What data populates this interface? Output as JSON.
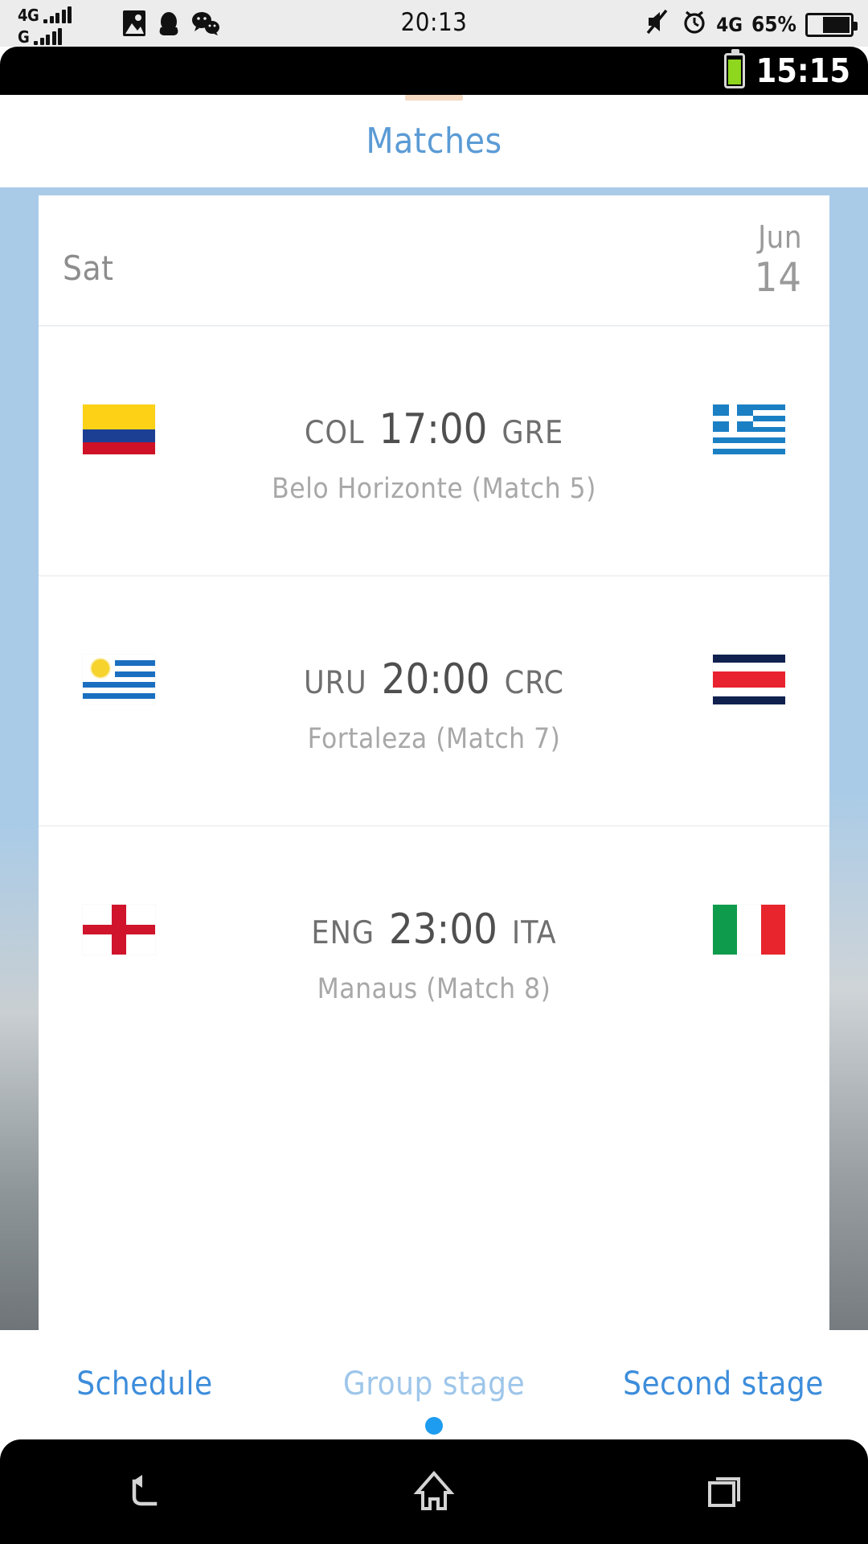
{
  "os_status_bar": {
    "network_rows": [
      {
        "label": "4G",
        "icon": "signal-bars-icon",
        "bars": 5
      },
      {
        "label": "G",
        "icon": "signal-bars-icon",
        "bars": 4
      }
    ],
    "notification_icons": [
      "image-icon",
      "qq-penguin-icon",
      "wechat-icon"
    ],
    "clock": "20:13",
    "right_icons": [
      "mute-icon",
      "alarm-icon"
    ],
    "data_label": "4G",
    "battery_percent": "65%",
    "battery_icon": "battery-icon"
  },
  "inner_status_bar": {
    "battery_icon": "battery-icon",
    "clock": "15:15"
  },
  "header": {
    "title": "Matches"
  },
  "schedule": {
    "date_header": {
      "day_of_week": "Sat",
      "month": "Jun",
      "day": "14"
    },
    "matches": [
      {
        "home_code": "COL",
        "home_flag": "colombia-flag",
        "kickoff": "17:00",
        "away_code": "GRE",
        "away_flag": "greece-flag",
        "venue": "Belo Horizonte (Match  5)"
      },
      {
        "home_code": "URU",
        "home_flag": "uruguay-flag",
        "kickoff": "20:00",
        "away_code": "CRC",
        "away_flag": "costa-rica-flag",
        "venue": "Fortaleza (Match  7)"
      },
      {
        "home_code": "ENG",
        "home_flag": "england-flag",
        "kickoff": "23:00",
        "away_code": "ITA",
        "away_flag": "italy-flag",
        "venue": "Manaus (Match  8)"
      }
    ]
  },
  "tabs": [
    {
      "label": "Schedule",
      "state": "active"
    },
    {
      "label": "Group stage",
      "state": "dim"
    },
    {
      "label": "Second stage",
      "state": "other"
    }
  ],
  "nav_bar": {
    "buttons": [
      "back-icon",
      "home-icon",
      "recents-icon"
    ]
  },
  "colors": {
    "accent_blue": "#3d8ddb",
    "title_blue": "#5b9bd5",
    "rail_blue": "#a9cbe8",
    "dot_blue": "#1e9cf0",
    "text_gray": "#6f6f6f",
    "muted_gray": "#a8a8a8"
  }
}
